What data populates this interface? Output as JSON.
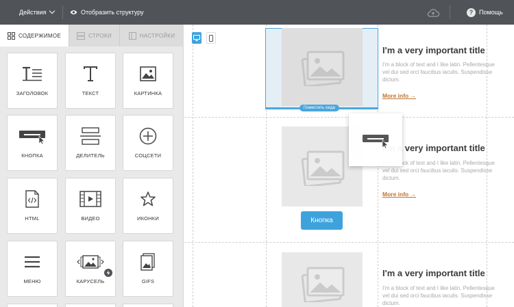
{
  "topbar": {
    "actions_label": "Действия",
    "structure_label": "Отобразить структуру",
    "help_label": "Помощь"
  },
  "sidebar": {
    "tabs": [
      {
        "label": "СОДЕРЖИМОЕ",
        "icon": "grid-icon",
        "active": true
      },
      {
        "label": "СТРОКИ",
        "icon": "rows-icon",
        "active": false
      },
      {
        "label": "НАСТРОЙКИ",
        "icon": "settings-icon",
        "active": false
      }
    ],
    "blocks": [
      {
        "label": "ЗАГОЛОВОК",
        "icon": "heading-icon"
      },
      {
        "label": "ТЕКСТ",
        "icon": "text-icon"
      },
      {
        "label": "КАРТИНКА",
        "icon": "image-icon"
      },
      {
        "label": "КНОПКА",
        "icon": "button-icon"
      },
      {
        "label": "ДЕЛИТЕЛЬ",
        "icon": "divider-icon"
      },
      {
        "label": "СОЦСЕТИ",
        "icon": "social-icon"
      },
      {
        "label": "HTML",
        "icon": "html-icon"
      },
      {
        "label": "ВИДЕО",
        "icon": "video-icon"
      },
      {
        "label": "ИКОНКИ",
        "icon": "star-icon"
      },
      {
        "label": "МЕНЮ",
        "icon": "menu-icon"
      },
      {
        "label": "КАРУСЕЛЬ",
        "icon": "carousel-icon"
      },
      {
        "label": "GIFS",
        "icon": "gifs-icon"
      }
    ]
  },
  "canvas": {
    "drop_label": "Поместить сюда",
    "button_label": "Кнопка",
    "rows": [
      {
        "title": "I'm a very important title",
        "text": "I'm a block of text and I like latin. Pellentesque vel dui sed orci faucibus iaculis. Suspendisse dictum.",
        "link": "More info →"
      },
      {
        "title": "I'm a very important title",
        "text": "I'm a block of text and I like latin. Pellentesque vel dui sed orci faucibus iaculis. Suspendisse dictum.",
        "link": "More info →"
      },
      {
        "title": "I'm a very important title",
        "text": "I'm a block of text and I like latin. Pellentesque vel dui sed orci faucibus iaculis. Suspendisse dictum.",
        "link": ""
      }
    ]
  },
  "colors": {
    "topbar": "#505458",
    "accent": "#3ea3dd",
    "link": "#c0722f",
    "sidebar_bg": "#e9e9e9"
  }
}
